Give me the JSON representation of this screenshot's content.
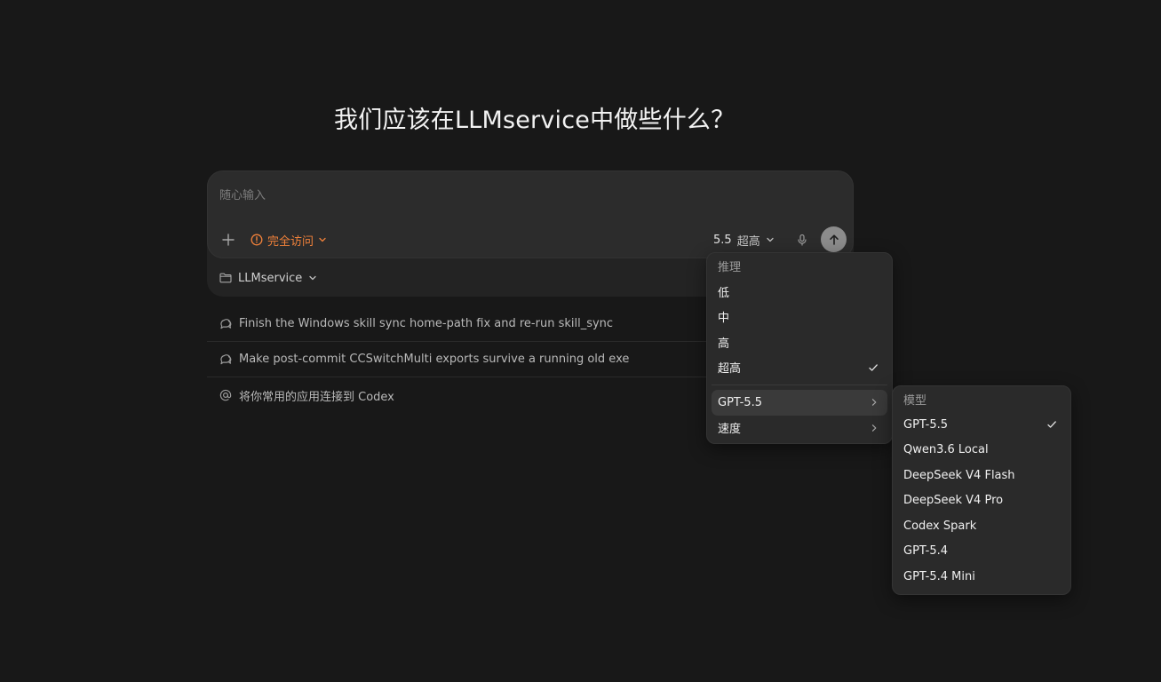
{
  "headline": "我们应该在LLMservice中做些什么？",
  "composer": {
    "placeholder": "随心输入",
    "access_label": "完全访问",
    "model_version": "5.5",
    "reasoning_level": "超高",
    "project_label": "LLMservice"
  },
  "suggestions": [
    {
      "icon": "chat-icon",
      "text": "Finish the Windows skill sync home-path fix and re-run skill_sync"
    },
    {
      "icon": "chat-icon",
      "text": "Make post-commit CCSwitchMulti exports survive a running old exe"
    },
    {
      "icon": "at-icon",
      "text": "将你常用的应用连接到 Codex"
    }
  ],
  "reasoning_menu": {
    "header": "推理",
    "items": [
      {
        "label": "低",
        "selected": false
      },
      {
        "label": "中",
        "selected": false
      },
      {
        "label": "高",
        "selected": false
      },
      {
        "label": "超高",
        "selected": true
      }
    ],
    "submenus": [
      {
        "label": "GPT-5.5"
      },
      {
        "label": "速度"
      }
    ]
  },
  "model_menu": {
    "header": "模型",
    "items": [
      {
        "label": "GPT-5.5",
        "selected": true
      },
      {
        "label": "Qwen3.6 Local",
        "selected": false
      },
      {
        "label": "DeepSeek V4 Flash",
        "selected": false
      },
      {
        "label": "DeepSeek V4 Pro",
        "selected": false
      },
      {
        "label": "Codex Spark",
        "selected": false
      },
      {
        "label": "GPT-5.4",
        "selected": false
      },
      {
        "label": "GPT-5.4 Mini",
        "selected": false
      }
    ]
  },
  "colors": {
    "background": "#181818",
    "accent_orange": "#f0813a",
    "menu_bg": "#2a2a2a"
  }
}
